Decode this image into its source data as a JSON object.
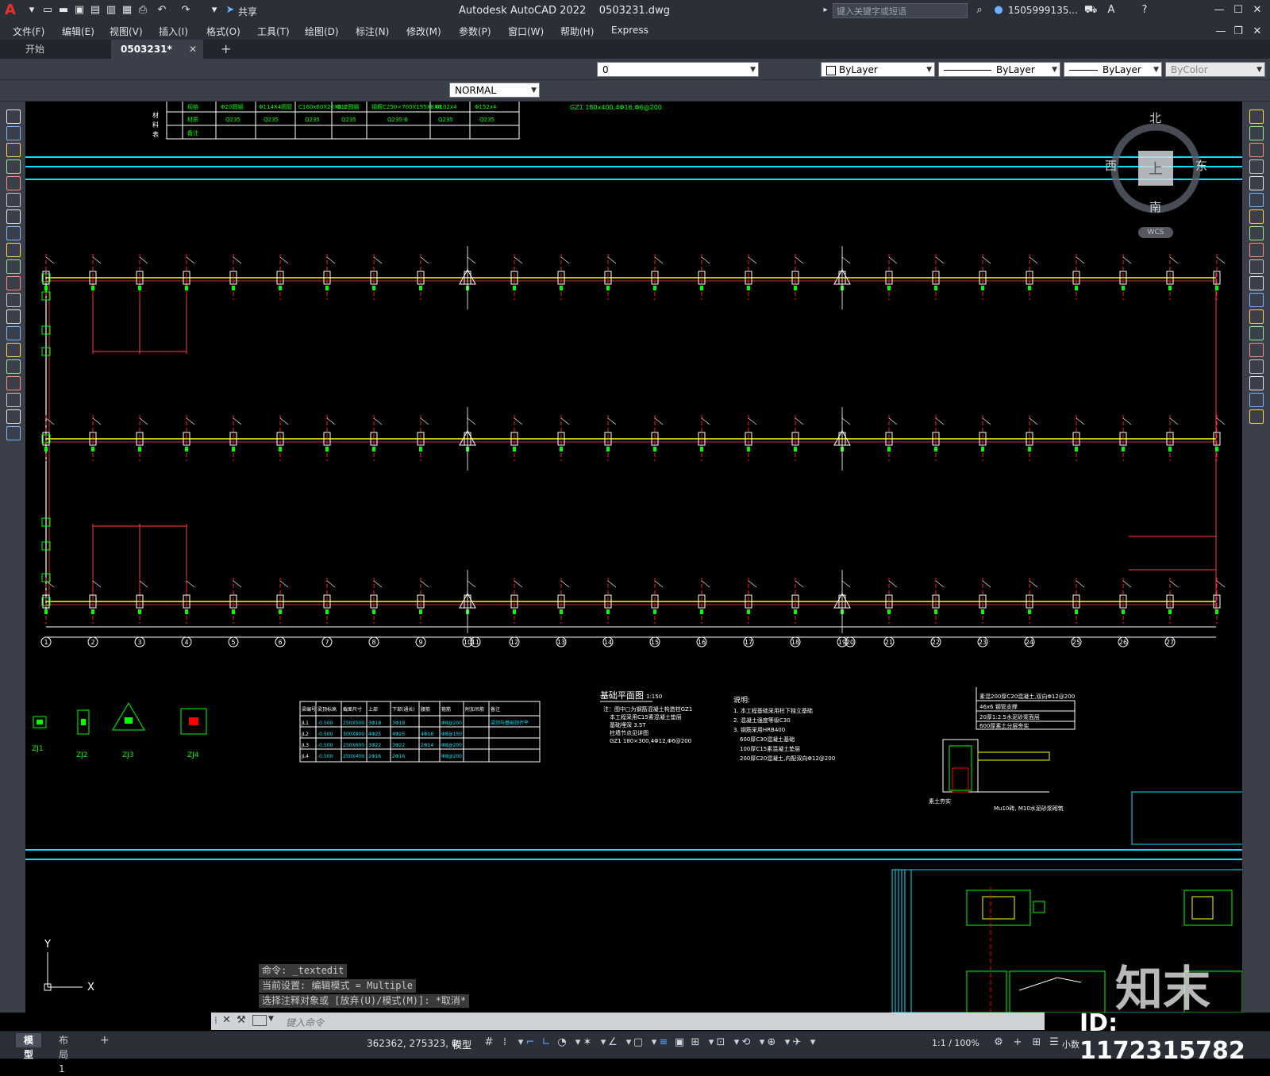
{
  "titlebar": {
    "app_name": "Autodesk AutoCAD 2022",
    "file_name": "0503231.dwg",
    "share_label": "共享",
    "search_placeholder": "键入关键字或短语",
    "user_name": "1505999135..."
  },
  "menu": [
    "文件(F)",
    "编辑(E)",
    "视图(V)",
    "插入(I)",
    "格式(O)",
    "工具(T)",
    "绘图(D)",
    "标注(N)",
    "修改(M)",
    "参数(P)",
    "窗口(W)",
    "帮助(H)",
    "Express"
  ],
  "tabs": {
    "start": "开始",
    "drawing": "0503231*"
  },
  "toolbar": {
    "layer_value": "0",
    "color_value": "ByLayer",
    "linetype_value": "ByLayer",
    "lineweight_value": "ByLayer",
    "plotstyle_value": "ByColor",
    "dimstyle_value": "NORMAL"
  },
  "viewcube": {
    "north": "北",
    "south": "南",
    "east": "东",
    "west": "西",
    "top": "上",
    "wcs": "WCS"
  },
  "drawing": {
    "grid_numbers": [
      "1",
      "2",
      "3",
      "4",
      "5",
      "6",
      "7",
      "8",
      "9",
      "10",
      "11",
      "12",
      "13",
      "14",
      "15",
      "16",
      "17",
      "18",
      "19",
      "20",
      "21",
      "22",
      "23",
      "24",
      "25",
      "26",
      "27"
    ],
    "plan_title": "基础平面图",
    "plan_scale": "1:150",
    "plan_notes": [
      "注：图中□为钢筋混凝土构造柱GZ1",
      "本工程采用C15素混凝土垫层",
      "基础埋深 3.5T",
      "柱墙节点见详图",
      "GZ1 180×300,4Φ12,Φ6@200"
    ],
    "beam_table_header": [
      "梁编号",
      "梁顶标高",
      "截面尺寸",
      "上部",
      "下部(通长)",
      "腰筋",
      "箍筋",
      "附加吊筋",
      "备注"
    ],
    "beam_table_rows": [
      [
        "JL1",
        "-0.500",
        "250X500",
        "3Φ18",
        "3Φ18",
        "",
        "Φ8@200",
        "",
        "梁顶与基础顶齐平"
      ],
      [
        "JL2",
        "-0.500",
        "300X800",
        "4Φ25",
        "4Φ25",
        "4Φ16",
        "Φ8@150",
        "",
        ""
      ],
      [
        "JL3",
        "-0.500",
        "250X600",
        "3Φ22",
        "3Φ22",
        "2Φ14",
        "Φ8@200",
        "",
        ""
      ],
      [
        "JL4",
        "-0.500",
        "250X400",
        "2Φ16",
        "2Φ16",
        "",
        "Φ8@200",
        "",
        ""
      ]
    ],
    "footing_labels": [
      "ZJ1",
      "ZJ2",
      "ZJ3",
      "ZJ4"
    ],
    "notes_title": "说明:",
    "notes_lines": [
      "1. 本工程基础采用柱下独立基础",
      "2. 混凝土强度等级C30",
      "3. 钢筋采用HRB400",
      "600厚C30混凝土基础",
      "100厚C15素混凝土垫层",
      "200厚C20混凝土,内配双向Φ12@200"
    ],
    "detail_notes": [
      "素混200厚C20混凝土,双向Φ12@200",
      "46x6 钢管支撑",
      "20厚1:2.5水泥砂浆面层",
      "600厚素土分层夯实",
      "素土夯实"
    ],
    "detail_footer": "Mu10砖, M10水泥砂浆砌筑",
    "ucs_y": "Y",
    "ucs_x": "X"
  },
  "command": {
    "history": [
      "命令: _textedit",
      "当前设置: 编辑模式 = Multiple",
      "选择注释对象或 [放弃(U)/模式(M)]: *取消*"
    ],
    "placeholder": "键入命令"
  },
  "statusbar": {
    "layout_tabs": [
      "模型",
      "布局1"
    ],
    "coords": "362362, 275323, 0",
    "model_label": "模型",
    "scale": "1:1 / 100%",
    "units": "小数"
  },
  "watermark": {
    "brand": "知末",
    "id": "ID: 1172315782"
  },
  "colors": {
    "accent_red": "#e8332b",
    "cad_cyan": "#00e5ff",
    "cad_green": "#00ff00",
    "cad_yellow": "#ffff00",
    "cad_red": "#ff0000",
    "cad_white": "#ffffff",
    "ui_dark": "#2b2f38",
    "ui_toolbar": "#3b3f49"
  }
}
